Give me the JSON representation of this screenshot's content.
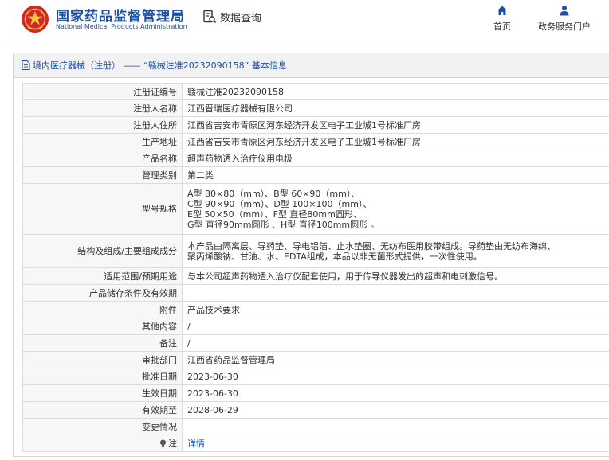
{
  "header": {
    "brand_cn": "国家药品监督管理局",
    "brand_en": "National Medical Products Administration",
    "query_label": "数据查询",
    "nav": [
      {
        "label": "首页",
        "icon": "home-icon"
      },
      {
        "label": "政务服务门户",
        "icon": "user-icon"
      }
    ]
  },
  "panel": {
    "title": "境内医疗器械（注册） —— “赣械注准20232090158” 基本信息"
  },
  "rows": [
    {
      "label": "注册证编号",
      "value": "赣械注准20232090158"
    },
    {
      "label": "注册人名称",
      "value": "江西晋瑞医疗器械有限公司"
    },
    {
      "label": "注册人住所",
      "value": "江西省吉安市青原区河东经济开发区电子工业城1号标准厂房"
    },
    {
      "label": "生产地址",
      "value": "江西省吉安市青原区河东经济开发区电子工业城1号标准厂房"
    },
    {
      "label": "产品名称",
      "value": "超声药物透入治疗仪用电极"
    },
    {
      "label": "管理类别",
      "value": "第二类"
    },
    {
      "label": "型号规格",
      "lines": [
        "A型 80×80（mm）、B型 60×90（mm）、",
        "C型 90×90（mm）、D型 100×100（mm）、",
        "E型 50×50（mm）、F型 直径80mm圆形、",
        "G型 直径90mm圆形 、H型 直径100mm圆形 。"
      ]
    },
    {
      "label": "结构及组成/主要组成成分",
      "lines": [
        "本产品由隔离层、导药垫、导电铝箔、止水垫圈、无纺布医用胶带组成。导药垫由无纺布海绵、",
        "聚丙烯酸钠、甘油、水、EDTA组成，本品以非无菌形式提供，一次性使用。"
      ]
    },
    {
      "label": "适用范围/预期用途",
      "value": "与本公司超声药物透入治疗仪配套使用，用于传导仪器发出的超声和电刺激信号。"
    },
    {
      "label": "产品储存条件及有效期",
      "value": ""
    },
    {
      "label": "附件",
      "value": "产品技术要求"
    },
    {
      "label": "其他内容",
      "value": "/"
    },
    {
      "label": "备注",
      "value": "/"
    },
    {
      "label": "审批部门",
      "value": "江西省药品监督管理局"
    },
    {
      "label": "批准日期",
      "value": "2023-06-30"
    },
    {
      "label": "生效日期",
      "value": "2023-06-30"
    },
    {
      "label": "有效期至",
      "value": "2028-06-29"
    },
    {
      "label": "变更情况",
      "value": ""
    },
    {
      "label": "注",
      "value": "详情"
    }
  ],
  "colors": {
    "brand": "#1c50a8",
    "emblem": "#d2262c"
  }
}
